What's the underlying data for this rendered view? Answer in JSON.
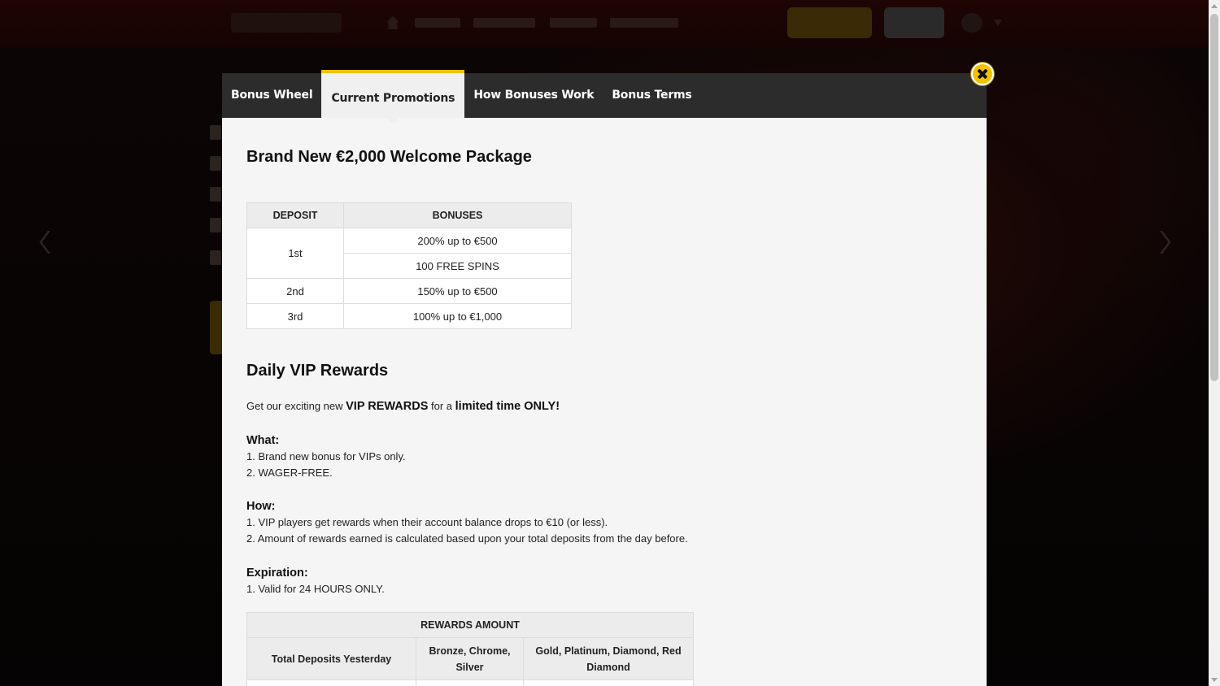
{
  "modal": {
    "tabs": [
      {
        "label": "Bonus Wheel",
        "active": false
      },
      {
        "label": "Current Promotions",
        "active": true
      },
      {
        "label": "How Bonuses Work",
        "active": false
      },
      {
        "label": "Bonus Terms",
        "active": false
      }
    ],
    "close_icon": "close-icon",
    "accent_color": "#f2c200"
  },
  "welcome": {
    "title": "Brand New €2,000 Welcome Package",
    "headers": {
      "deposit": "DEPOSIT",
      "bonuses": "BONUSES"
    },
    "rows": [
      {
        "deposit": "1st",
        "bonuses": [
          "200% up to €500",
          "100 FREE SPINS"
        ]
      },
      {
        "deposit": "2nd",
        "bonuses": [
          "150% up to €500"
        ]
      },
      {
        "deposit": "3rd",
        "bonuses": [
          "100% up to €1,000"
        ]
      }
    ]
  },
  "vip": {
    "title": "Daily VIP Rewards",
    "intro_prefix": "Get our exciting new ",
    "intro_bold1": "VIP REWARDS",
    "intro_mid": " for a ",
    "intro_bold2": "limited time ONLY!",
    "what_label": "What:",
    "what_items": [
      "1. Brand new bonus for VIPs only.",
      "2. WAGER-FREE."
    ],
    "how_label": "How:",
    "how_items": [
      "1. VIP players get rewards when their account balance drops to €10 (or less).",
      "2. Amount of rewards earned is calculated based upon your total deposits from the day before."
    ],
    "expiration_label": "Expiration:",
    "expiration_items": [
      "1. Valid for 24 HOURS ONLY."
    ],
    "rewards_table": {
      "title": "REWARDS AMOUNT",
      "col1": "Total Deposits Yesterday",
      "col2": "Bronze, Chrome, Silver",
      "col3": "Gold, Platinum, Diamond, Red Diamond"
    }
  }
}
